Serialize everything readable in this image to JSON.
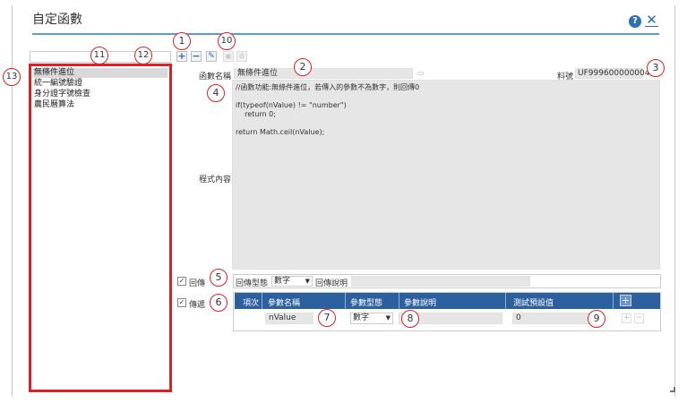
{
  "window": {
    "title": "自定函數"
  },
  "functions": [
    {
      "label": "無條件進位",
      "selected": true
    },
    {
      "label": "統一編號驗證",
      "selected": false
    },
    {
      "label": "身分證字號檢查",
      "selected": false
    },
    {
      "label": "農民曆算法",
      "selected": false
    }
  ],
  "toolbar": {
    "add": "+",
    "remove": "−",
    "edit": "✎",
    "save": "▣",
    "cancel": "⊘"
  },
  "form": {
    "name_label": "函數名稱",
    "name_value": "無條件進位",
    "id_label": "料號",
    "id_value": "UF999600000004",
    "code_label": "程式內容",
    "code": "//函數功能:無條件進位，若傳入的參數不為數字，則回傳0\n\nif(typeof(nValue) != \"number\")\n    return 0;\n\nreturn Math.ceil(nValue);"
  },
  "return_row": {
    "checkbox_label": "回傳",
    "type_label": "回傳型態",
    "type_value": "數字",
    "desc_label": "回傳說明"
  },
  "params": {
    "checkbox_label": "傳遞",
    "headers": [
      "項次",
      "參數名稱",
      "參數型態",
      "參數說明",
      "測試預設值"
    ],
    "rows": [
      {
        "name": "nValue",
        "type": "數字",
        "desc": "",
        "default": "0"
      }
    ]
  },
  "callouts": [
    "1",
    "2",
    "3",
    "4",
    "5",
    "6",
    "7",
    "8",
    "9",
    "10",
    "11",
    "12",
    "13"
  ],
  "icons": {
    "help": "help-icon",
    "close": "close-icon"
  },
  "colors": {
    "accent": "#2c5f9e",
    "callout": "#e02020",
    "field": "#e6e6e6"
  }
}
